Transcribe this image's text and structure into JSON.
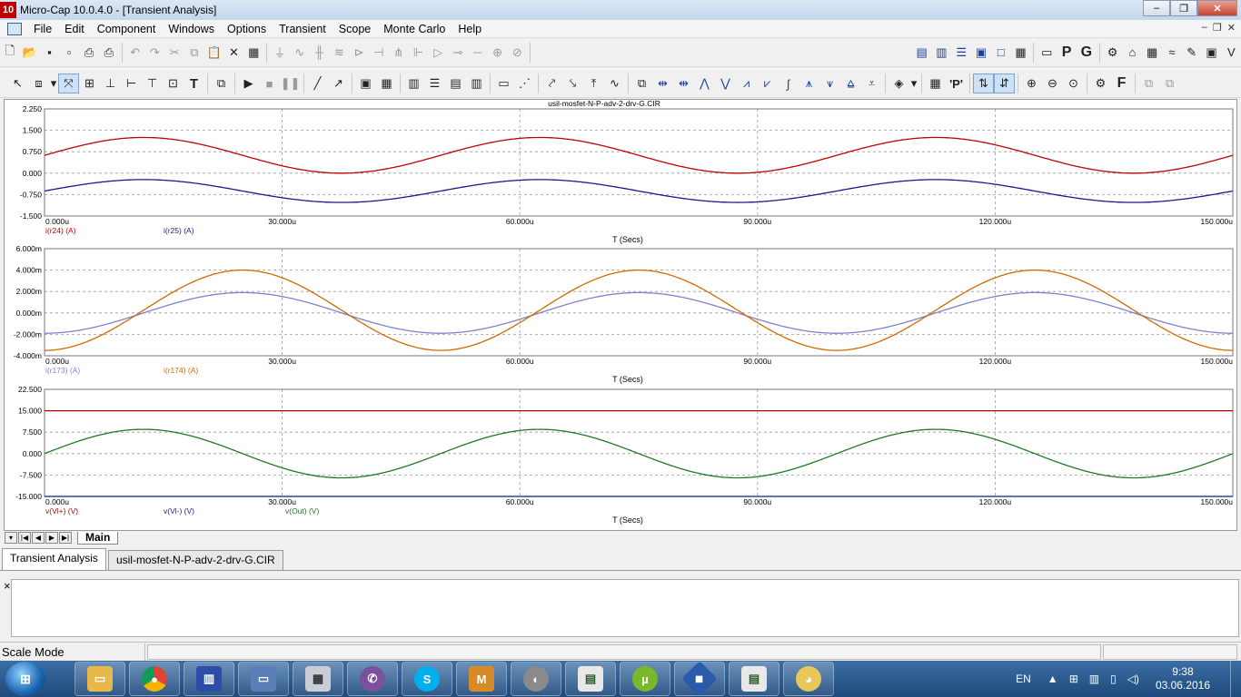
{
  "window": {
    "title": "Micro-Cap 10.0.4.0 - [Transient Analysis]",
    "app_icon_label": "10",
    "minimize": "‒",
    "maximize": "❐",
    "close": "✕"
  },
  "menu": {
    "items": [
      "File",
      "Edit",
      "Component",
      "Windows",
      "Options",
      "Transient",
      "Scope",
      "Monte Carlo",
      "Help"
    ],
    "mdi_minimize": "‒",
    "mdi_restore": "❐",
    "mdi_close": "✕"
  },
  "plots": {
    "filename": "usil-mosfet-N-P-adv-2-drv-G.CIR",
    "xlabel": "T (Secs)",
    "x_ticks": [
      "0.000u",
      "30.000u",
      "60.000u",
      "90.000u",
      "120.000u",
      "150.000u"
    ],
    "colors": {
      "red": "#c00000",
      "darkblue": "#1a1a8c",
      "lavender": "#8080d0",
      "orange": "#d06a00",
      "green": "#1e7a1e",
      "navy": "#0b1f8c",
      "grid": "#9a9a9a"
    }
  },
  "chart_data": [
    {
      "type": "line",
      "xlabel": "T (Secs)",
      "xlim": [
        0,
        150
      ],
      "x_unit": "u",
      "x_ticks": [
        "0.000u",
        "30.000u",
        "60.000u",
        "90.000u",
        "120.000u",
        "150.000u"
      ],
      "ylim": [
        -1.5,
        2.25
      ],
      "y_ticks": [
        "2.250",
        "1.500",
        "0.750",
        "0.000",
        "-0.750",
        "-1.500"
      ],
      "grid": true,
      "series": [
        {
          "name": "i(r24) (A)",
          "color": "#c00000",
          "offset": 0.625,
          "amplitude": 0.625,
          "period": 50,
          "peak_at": 12.5
        },
        {
          "name": "i(r25) (A)",
          "color": "#1a1a8c",
          "offset": -0.625,
          "amplitude": 0.4,
          "period": 50,
          "peak_at": 12.5
        }
      ]
    },
    {
      "type": "line",
      "xlabel": "T (Secs)",
      "xlim": [
        0,
        150
      ],
      "x_unit": "u",
      "x_ticks": [
        "0.000u",
        "30.000u",
        "60.000u",
        "90.000u",
        "120.000u",
        "150.000u"
      ],
      "ylim": [
        -4.0,
        6.0
      ],
      "y_ticks": [
        "6.000m",
        "4.000m",
        "2.000m",
        "0.000m",
        "-2.000m",
        "-4.000m"
      ],
      "grid": true,
      "series": [
        {
          "name": "i(r173) (A)",
          "color": "#8080d0",
          "offset": 0.0,
          "amplitude": 1.9,
          "period": 50,
          "peak_at": 25
        },
        {
          "name": "i(r174) (A)",
          "color": "#d06a00",
          "offset": 0.25,
          "amplitude": 3.75,
          "period": 50,
          "peak_at": 25
        }
      ]
    },
    {
      "type": "line",
      "xlabel": "T (Secs)",
      "xlim": [
        0,
        150
      ],
      "x_unit": "u",
      "x_ticks": [
        "0.000u",
        "30.000u",
        "60.000u",
        "90.000u",
        "120.000u",
        "150.000u"
      ],
      "ylim": [
        -15.0,
        22.5
      ],
      "y_ticks": [
        "22.500",
        "15.000",
        "7.500",
        "0.000",
        "-7.500",
        "-15.000"
      ],
      "grid": true,
      "series": [
        {
          "name": "v(Vl+) (V)",
          "color": "#c00000",
          "offset": 15.0,
          "amplitude": 0.0,
          "period": 50,
          "peak_at": 12.5
        },
        {
          "name": "v(Vl-) (V)",
          "color": "#0b1f8c",
          "offset": -15.0,
          "amplitude": 0.0,
          "period": 50,
          "peak_at": 12.5
        },
        {
          "name": "v(Out) (V)",
          "color": "#1e7a1e",
          "offset": 0.0,
          "amplitude": 8.5,
          "period": 50,
          "peak_at": 12.5
        }
      ]
    }
  ],
  "sheet": {
    "tab": "Main"
  },
  "doc_tabs": [
    "Transient Analysis",
    "usil-mosfet-N-P-adv-2-drv-G.CIR"
  ],
  "output": {
    "close": "×"
  },
  "status": {
    "mode": "Scale Mode"
  },
  "taskbar": {
    "apps": [
      "file-explorer",
      "chrome",
      "winrar",
      "remote-desktop",
      "calculator",
      "viber",
      "skype",
      "mfc",
      "media-player",
      "notepad-reader",
      "utorrent",
      "micro-cap",
      "document-viewer",
      "paint"
    ],
    "language": "EN",
    "time": "9:38",
    "date": "03.06.2016"
  }
}
